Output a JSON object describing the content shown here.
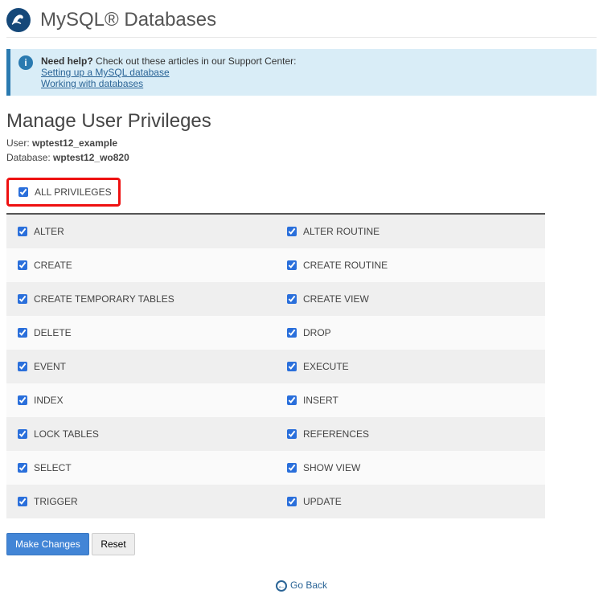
{
  "header": {
    "title": "MySQL® Databases"
  },
  "notice": {
    "lead": "Need help?",
    "text": " Check out these articles in our Support Center:",
    "links": [
      "Setting up a MySQL database",
      "Working with databases"
    ]
  },
  "section": {
    "title": "Manage User Privileges",
    "user_label": "User: ",
    "user_value": "wptest12_example",
    "db_label": "Database: ",
    "db_value": "wptest12_wo820"
  },
  "all_privileges_label": "ALL PRIVILEGES",
  "privileges": [
    {
      "left": "ALTER",
      "right": "ALTER ROUTINE"
    },
    {
      "left": "CREATE",
      "right": "CREATE ROUTINE"
    },
    {
      "left": "CREATE TEMPORARY TABLES",
      "right": "CREATE VIEW"
    },
    {
      "left": "DELETE",
      "right": "DROP"
    },
    {
      "left": "EVENT",
      "right": "EXECUTE"
    },
    {
      "left": "INDEX",
      "right": "INSERT"
    },
    {
      "left": "LOCK TABLES",
      "right": "REFERENCES"
    },
    {
      "left": "SELECT",
      "right": "SHOW VIEW"
    },
    {
      "left": "TRIGGER",
      "right": "UPDATE"
    }
  ],
  "actions": {
    "primary": "Make Changes",
    "reset": "Reset"
  },
  "go_back": "Go Back"
}
